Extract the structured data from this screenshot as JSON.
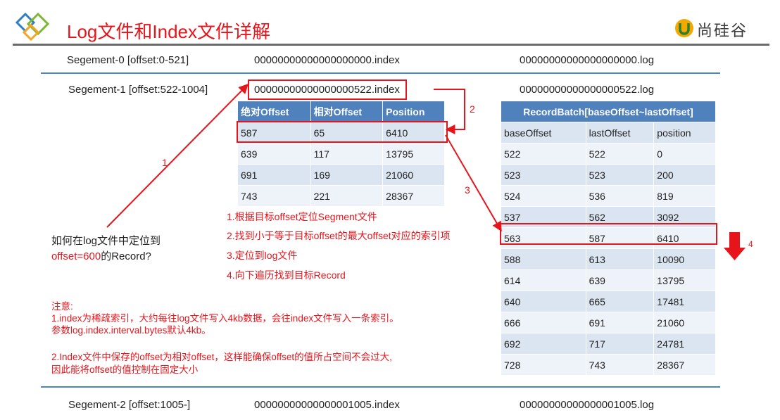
{
  "header": {
    "title": "Log文件和Index文件详解",
    "brand": "尚硅谷"
  },
  "segments": [
    {
      "label": "Segement-0 [offset:0-521]",
      "index_file": "00000000000000000000.index",
      "log_file": "00000000000000000000.log"
    },
    {
      "label": "Segement-1 [offset:522-1004]",
      "index_file": "00000000000000000522.index",
      "log_file": "00000000000000000522.log"
    },
    {
      "label": "Segement-2 [offset:1005-]",
      "index_file": "00000000000000001005.index",
      "log_file": "00000000000000001005.log"
    }
  ],
  "index_table": {
    "headers": [
      "绝对Offset",
      "相对Offset",
      "Position"
    ],
    "rows": [
      [
        "587",
        "65",
        "6410"
      ],
      [
        "639",
        "117",
        "13795"
      ],
      [
        "691",
        "169",
        "21060"
      ],
      [
        "743",
        "221",
        "28367"
      ]
    ]
  },
  "log_table": {
    "title": "RecordBatch[baseOffset~lastOffset]",
    "headers": [
      "baseOffset",
      "lastOffset",
      "position"
    ],
    "rows": [
      [
        "522",
        "522",
        "0"
      ],
      [
        "523",
        "523",
        "200"
      ],
      [
        "524",
        "536",
        "819"
      ],
      [
        "537",
        "562",
        "3092"
      ],
      [
        "563",
        "587",
        "6410"
      ],
      [
        "588",
        "613",
        "10090"
      ],
      [
        "614",
        "639",
        "13795"
      ],
      [
        "640",
        "665",
        "17481"
      ],
      [
        "666",
        "691",
        "21060"
      ],
      [
        "692",
        "717",
        "24781"
      ],
      [
        "728",
        "743",
        "28367"
      ]
    ]
  },
  "question": {
    "line1": "如何在log文件中定位到",
    "offset": "offset=600",
    "line2_rest": "的Record?"
  },
  "steps": [
    "1.根据目标offset定位Segment文件",
    "2.找到小于等于目标offset的最大offset对应的索引项",
    "3.定位到log文件",
    "4.向下遍历找到目标Record"
  ],
  "notes": {
    "heading": "注意:",
    "n1a": "1.index为稀疏索引，大约每往log文件写入4kb数据，会往index文件写入一条索引。",
    "n1b": "参数log.index.interval.bytes默认4kb。",
    "n2a": "2.Index文件中保存的offset为相对offset，这样能确保offset的值所占空间不会过大,",
    "n2b": "因此能将offset的值控制在固定大小"
  },
  "arrow_labels": [
    "1",
    "2",
    "3",
    "4"
  ],
  "colors": {
    "accent": "#e8141b",
    "table_header": "#4f81bd",
    "row_fill": "#dbe5f1",
    "rule": "#4a86c8"
  }
}
